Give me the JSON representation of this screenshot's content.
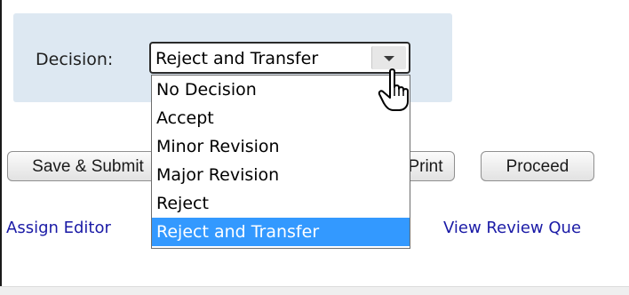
{
  "decision": {
    "label": "Decision:",
    "selected_value": "Reject and Transfer",
    "options": [
      {
        "label": "No Decision",
        "selected": false
      },
      {
        "label": "Accept",
        "selected": false
      },
      {
        "label": "Minor Revision",
        "selected": false
      },
      {
        "label": "Major Revision",
        "selected": false
      },
      {
        "label": "Reject",
        "selected": false
      },
      {
        "label": "Reject and Transfer",
        "selected": true
      }
    ]
  },
  "buttons": {
    "save_submit": "Save & Submit",
    "print": "Print",
    "proceed": "Proceed"
  },
  "links": {
    "assign_editor": "Assign Editor",
    "view_review": "View Review Que"
  },
  "icons": {
    "dropdown_arrow": "chevron-down-icon",
    "cursor": "hand-pointer-cursor-icon"
  },
  "colors": {
    "panel_bg": "#dde8f2",
    "highlight": "#3399ff",
    "link": "#1a1aa6"
  }
}
